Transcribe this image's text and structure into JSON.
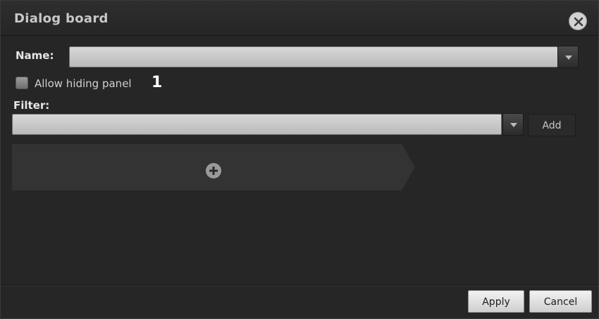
{
  "dialog": {
    "title": "Dialog board",
    "close_icon": "close-circle-icon"
  },
  "name_field": {
    "label": "Name:",
    "value": "",
    "dropdown_icon": "chevron-down-icon"
  },
  "allow_hiding": {
    "label": "Allow hiding panel",
    "checked": false,
    "callout_number": "1"
  },
  "filter_field": {
    "label": "Filter:",
    "value": "",
    "dropdown_icon": "chevron-down-icon",
    "add_label": "Add"
  },
  "panel_area": {
    "add_icon": "plus-circle-icon"
  },
  "footer": {
    "apply_label": "Apply",
    "cancel_label": "Cancel"
  }
}
